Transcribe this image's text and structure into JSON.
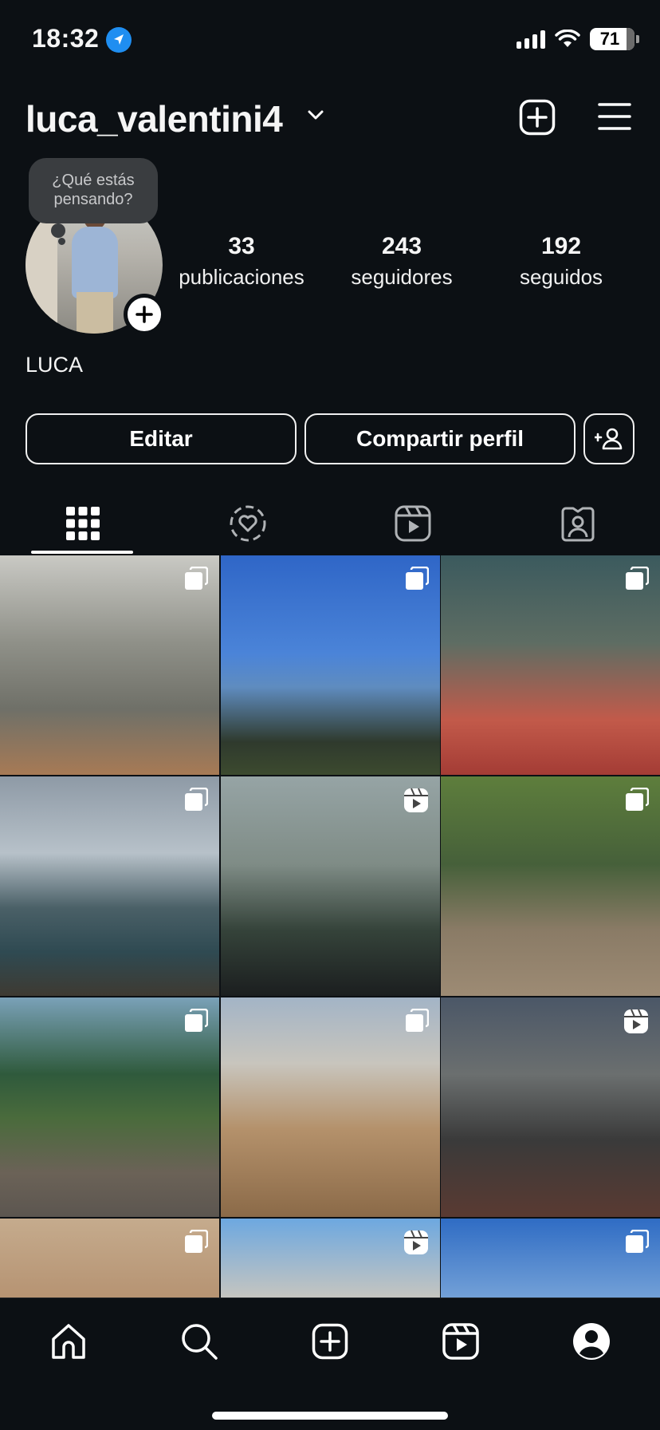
{
  "status_bar": {
    "time": "18:32",
    "battery": "71"
  },
  "header": {
    "username": "luca_valentini4"
  },
  "note": {
    "text_line1": "¿Qué estás",
    "text_line2": "pensando?"
  },
  "stats": {
    "posts": {
      "value": "33",
      "label": "publicaciones"
    },
    "followers": {
      "value": "243",
      "label": "seguidores"
    },
    "following": {
      "value": "192",
      "label": "seguidos"
    }
  },
  "profile": {
    "display_name": "LUCA"
  },
  "buttons": {
    "edit": "Editar",
    "share": "Compartir perfil"
  },
  "tabs": [
    "grid-icon",
    "tagged-heart-icon",
    "reels-icon",
    "tagged-person-icon"
  ],
  "grid": {
    "posts": [
      {
        "type": "multi"
      },
      {
        "type": "multi"
      },
      {
        "type": "multi"
      },
      {
        "type": "multi"
      },
      {
        "type": "reel"
      },
      {
        "type": "multi"
      },
      {
        "type": "multi"
      },
      {
        "type": "multi"
      },
      {
        "type": "reel"
      },
      {
        "type": "multi"
      },
      {
        "type": "reel"
      },
      {
        "type": "multi"
      }
    ]
  },
  "bottom_nav": [
    "home-icon",
    "search-icon",
    "create-icon",
    "reels-icon",
    "profile-icon"
  ],
  "colors": {
    "background": "#0c1014",
    "text": "#f5f5f5",
    "location": "#1f8ef1",
    "note_bubble": "#3a3d40"
  }
}
